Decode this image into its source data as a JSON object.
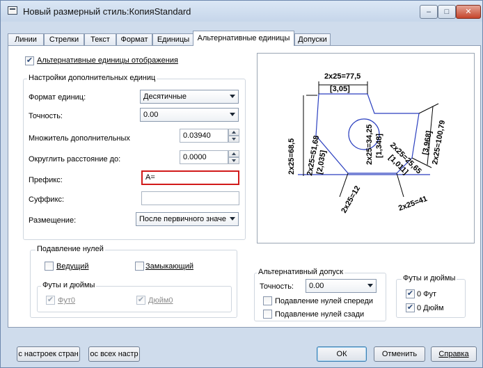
{
  "window": {
    "title": "Новый размерный стиль:КопияStandard"
  },
  "tabs": [
    {
      "label": "Линии"
    },
    {
      "label": "Стрелки"
    },
    {
      "label": "Текст"
    },
    {
      "label": "Формат"
    },
    {
      "label": "Единицы"
    },
    {
      "label": "Альтернативные единицы"
    },
    {
      "label": "Допуски"
    }
  ],
  "alt_display": {
    "label": "Альтернативные единицы отображения",
    "checked": true
  },
  "alt_units": {
    "legend": "Настройки дополнительных единиц",
    "format_label": "Формат единиц:",
    "format_value": "Десятичные",
    "precision_label": "Точность:",
    "precision_value": "0.00",
    "multiplier_label": "Множитель дополнительных",
    "multiplier_value": "0.03940",
    "round_label": "Округлить расстояние до:",
    "round_value": "0.0000",
    "prefix_label": "Префикс:",
    "prefix_value": "A=",
    "suffix_label": "Суффикс:",
    "suffix_value": "",
    "placement_label": "Размещение:",
    "placement_value": "После первичного значе"
  },
  "zero_suppression": {
    "legend": "Подавление нулей",
    "leading": "Ведущий",
    "trailing": "Замыкающий",
    "feet_inches_legend": "Футы и дюймы",
    "feet": "Фут0",
    "inches": "Дюйм0"
  },
  "alt_tolerance": {
    "legend": "Альтернативный допуск",
    "precision_label": "Точность:",
    "precision_value": "0.00",
    "suppress_leading": "Подавление нулей спереди",
    "suppress_trailing": "Подавление нулей сзади",
    "feet_inches_legend": "Футы и дюймы",
    "feet": "0 Фут",
    "inches": "0 Дюйм"
  },
  "preview": {
    "dim_top": "2x25=77,5",
    "dim_top_alt": "[3,05]",
    "dim_right": "2x25=100,79",
    "dim_right_alt": "[3,968]",
    "dim_left": "2x25=68,5",
    "dim_mid": "2x25=51,68",
    "dim_mid_alt": "[2,035]",
    "dim_center": "2x25=34,25",
    "dim_center_alt": "[1,348]",
    "dim_inner": "2x25=25,65",
    "dim_inner_alt": "[1,011]",
    "dim_arc": "2x25=12",
    "dim_angle": "2x25=41"
  },
  "buttons": {
    "from_page": "с настроек стран",
    "from_all": "ос всех настр",
    "ok": "ОК",
    "cancel": "Отменить",
    "help": "Справка"
  }
}
